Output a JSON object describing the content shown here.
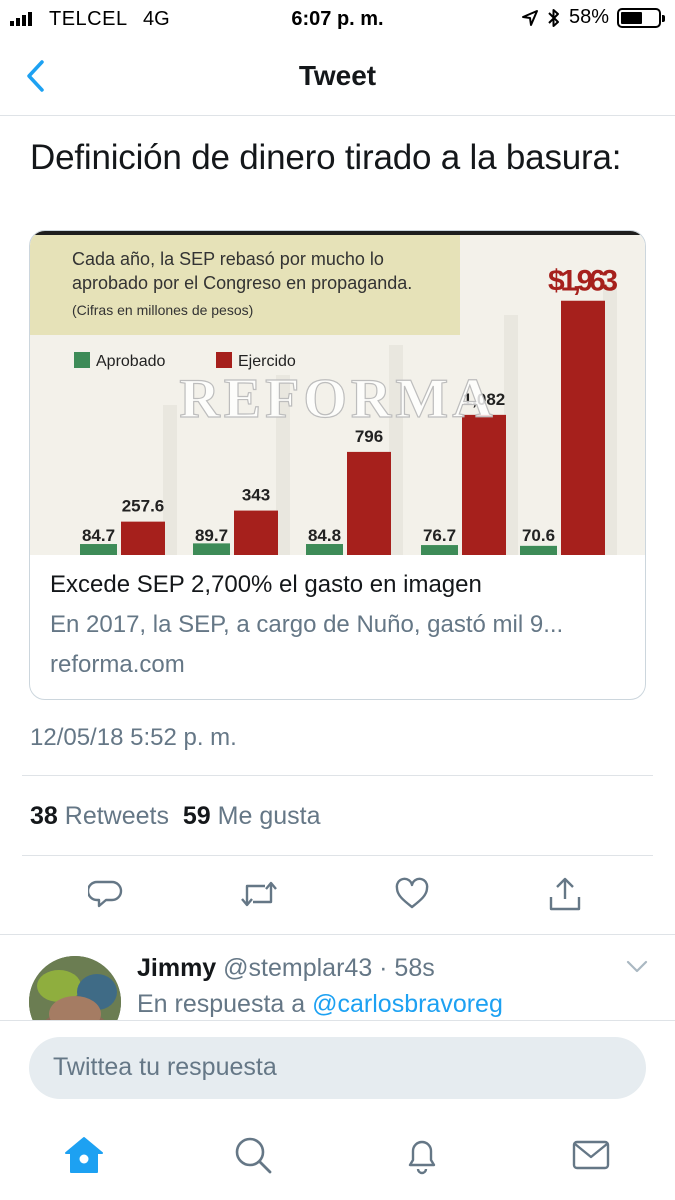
{
  "status_bar": {
    "carrier": "TELCEL",
    "network": "4G",
    "time": "6:07 p. m.",
    "battery": "58%",
    "battery_level": 0.58,
    "icons": [
      "signal-icon",
      "location-arrow-icon",
      "bluetooth-icon",
      "battery-icon"
    ]
  },
  "nav": {
    "title": "Tweet",
    "back_icon": "chevron-left-icon"
  },
  "tweet": {
    "text": "Definición de dinero tirado a la basura:",
    "timestamp": "12/05/18 5:52 p. m."
  },
  "card": {
    "image": {
      "caption_line1": "Cada año, la SEP rebasó por mucho lo",
      "caption_line2": "aprobado por el Congreso en propaganda.",
      "caption_line3": "(Cifras en millones de pesos)",
      "watermark": "REFORMA",
      "colors": {
        "aprobado": "#3d8b57",
        "ejercido": "#a6201c",
        "caption_bg": "#e6e2b8"
      }
    },
    "title": "Excede SEP 2,700% el gasto en imagen",
    "description": "En 2017, la SEP, a cargo de Nuño, gastó mil 9...",
    "domain": "reforma.com"
  },
  "chart_data": {
    "type": "bar",
    "categories": [
      "",
      "",
      "",
      "",
      ""
    ],
    "series": [
      {
        "name": "Aprobado",
        "labels": [
          "84.7",
          "89.7",
          "84.8",
          "76.7",
          "70.6"
        ],
        "values": [
          84.7,
          89.7,
          84.8,
          76.7,
          70.6
        ]
      },
      {
        "name": "Ejercido",
        "labels": [
          "257.6",
          "343",
          "796",
          "1,082",
          "$1,963"
        ],
        "values": [
          257.6,
          343,
          796,
          1082,
          1963
        ]
      }
    ],
    "ylim": [
      0,
      2100
    ],
    "grid": false,
    "legend": "top-left"
  },
  "stats": {
    "retweets_count": "38",
    "retweets_label": "Retweets",
    "likes_count": "59",
    "likes_label": "Me gusta"
  },
  "actions": [
    "reply-icon",
    "retweet-icon",
    "like-icon",
    "share-icon"
  ],
  "reply": {
    "name": "Jimmy",
    "handle_time": "@stemplar43 · 58s",
    "in_reply_prefix": "En respuesta a",
    "in_reply_user": "@carlosbravoreg"
  },
  "compose": {
    "placeholder": "Twittea tu respuesta"
  },
  "tabbar": [
    "home-icon",
    "search-icon",
    "notifications-icon",
    "messages-icon"
  ],
  "accent": "#1da1f2"
}
